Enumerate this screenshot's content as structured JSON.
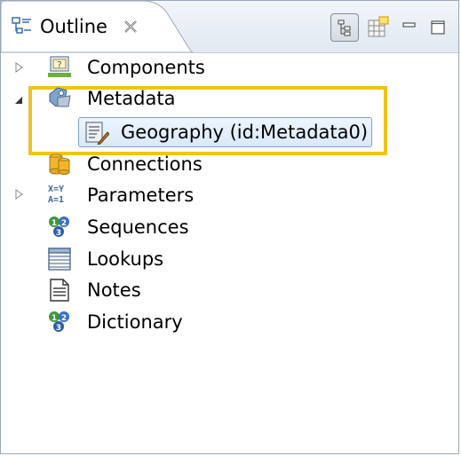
{
  "view": {
    "tab_title": "Outline",
    "close_symbol": "✕"
  },
  "toolbar": {
    "buttons": [
      "hierarchy-toggle-icon",
      "table-view-icon",
      "minimize-icon",
      "maximize-icon"
    ]
  },
  "tree": {
    "items": [
      {
        "label": "Components",
        "icon": "components-icon",
        "expandable": true,
        "expanded": false
      },
      {
        "label": "Metadata",
        "icon": "metadata-icon",
        "expandable": true,
        "expanded": true
      },
      {
        "label": "Geography (id:Metadata0)",
        "icon": "metadata-record-icon",
        "child": true,
        "selected": true
      },
      {
        "label": "Connections",
        "icon": "connections-icon",
        "expandable": false
      },
      {
        "label": "Parameters",
        "icon": "parameters-icon",
        "expandable": true,
        "expanded": false
      },
      {
        "label": "Sequences",
        "icon": "sequences-icon",
        "expandable": false
      },
      {
        "label": "Lookups",
        "icon": "lookups-icon",
        "expandable": false
      },
      {
        "label": "Notes",
        "icon": "notes-icon",
        "expandable": false
      },
      {
        "label": "Dictionary",
        "icon": "dictionary-icon",
        "expandable": false
      }
    ]
  },
  "colors": {
    "highlight": "#f2c21a",
    "selection_border": "#7da2ce"
  }
}
